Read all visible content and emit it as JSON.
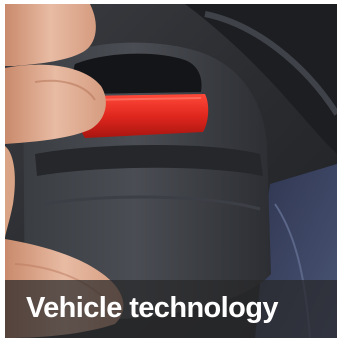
{
  "caption": {
    "text": "Vehicle technology"
  },
  "photo": {
    "subject": "seat-belt-buckle-release-button",
    "colors": {
      "buckle_red": "#e0271e",
      "housing_dark": "#2b2d31",
      "skin": "#e3b39a",
      "seat_fabric": "#3b4460",
      "caption_bar": "#28282a",
      "caption_text": "#ffffff"
    }
  }
}
